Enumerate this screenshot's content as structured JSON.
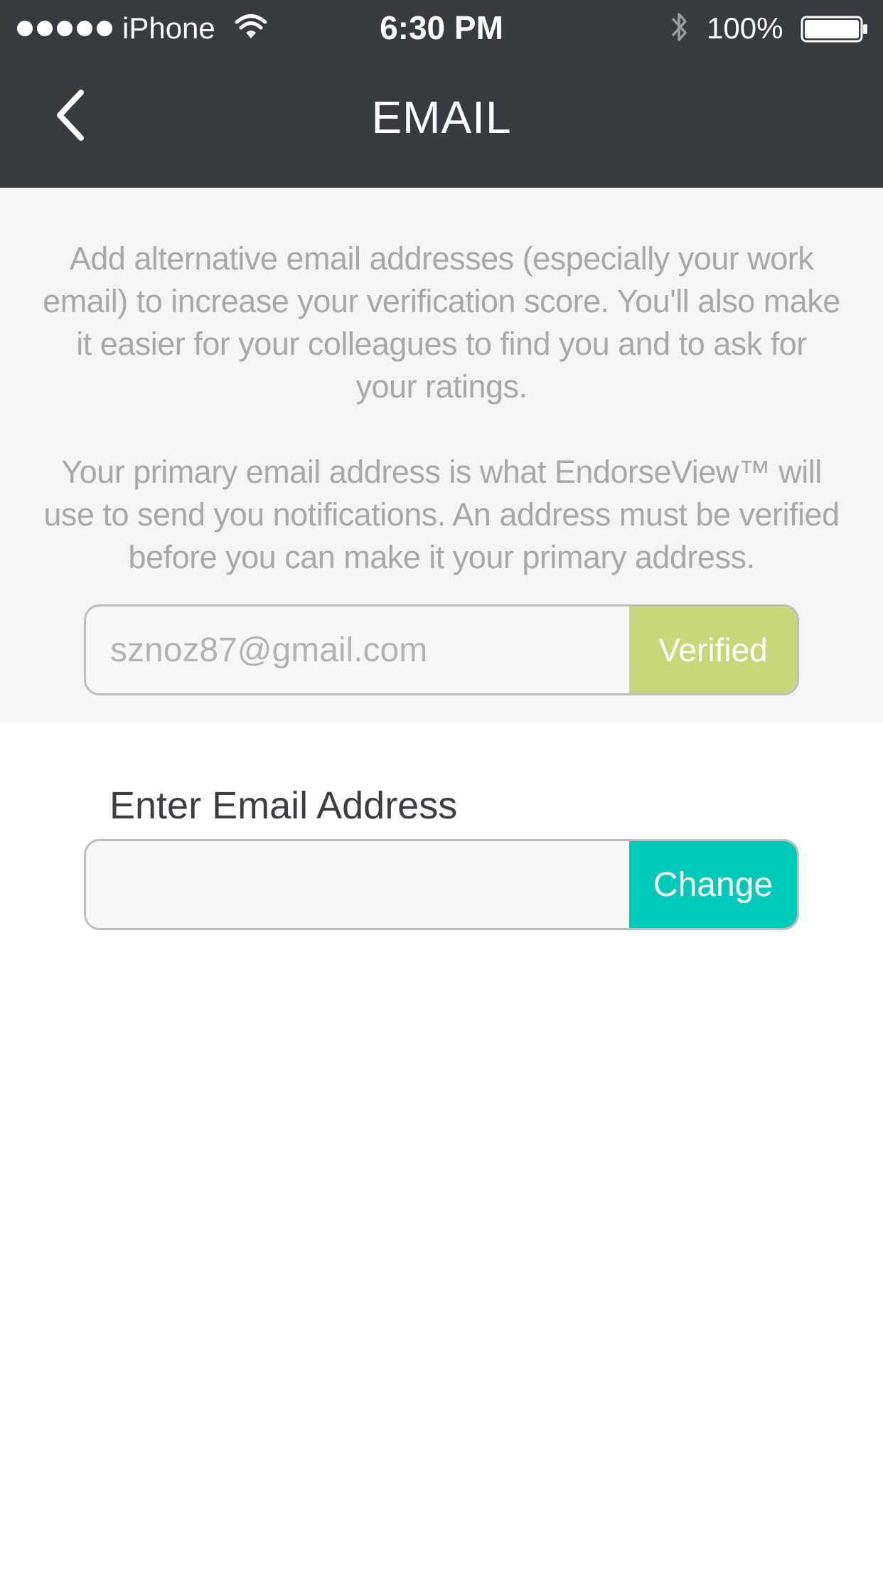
{
  "status_bar": {
    "carrier": "iPhone",
    "time": "6:30 PM",
    "battery_percent": "100%",
    "signal_bars": 5
  },
  "nav": {
    "title": "EMAIL",
    "back_icon": "chevron-left-icon"
  },
  "info": {
    "paragraph_1": "Add alternative email addresses (especially your work email) to increase your verification score. You'll also make it easier for your colleagues to find you and to ask for your ratings.",
    "paragraph_2": "Your primary email address is what EndorseView™ will use to send you notifications. An address must be verified before you can make it your primary address."
  },
  "primary_email": {
    "value": "sznoz87@gmail.com",
    "status_label": "Verified"
  },
  "new_email": {
    "label": "Enter Email Address",
    "value": "",
    "button_label": "Change"
  },
  "colors": {
    "header_bg": "#373b40",
    "info_bg": "#f5f5f5",
    "verified_bg": "#c9d67a",
    "change_bg": "#00c9b9"
  }
}
